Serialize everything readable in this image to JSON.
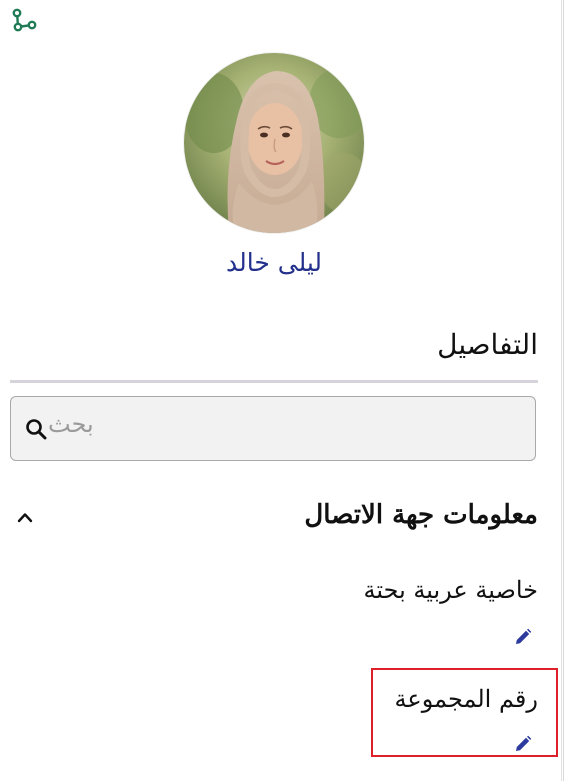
{
  "contact": {
    "name": "ليلى خالد"
  },
  "icons": {
    "share": "share-graph-icon",
    "search": "search-icon",
    "collapse": "chevron-up-icon",
    "edit": "pencil-icon"
  },
  "details": {
    "heading": "التفاصيل"
  },
  "search": {
    "placeholder": "بحث",
    "value": ""
  },
  "contact_info": {
    "title": "معلومات جهة الاتصال",
    "expanded": true,
    "fields": [
      {
        "label": "خاصية عربية بحتة",
        "value": ""
      },
      {
        "label": "رقم المجموعة",
        "value": "",
        "highlighted": true
      }
    ]
  },
  "colors": {
    "name": "#23308c",
    "share_icon": "#1f7a55",
    "edit_icon": "#2d3a9e",
    "highlight": "#dd1f2a"
  }
}
